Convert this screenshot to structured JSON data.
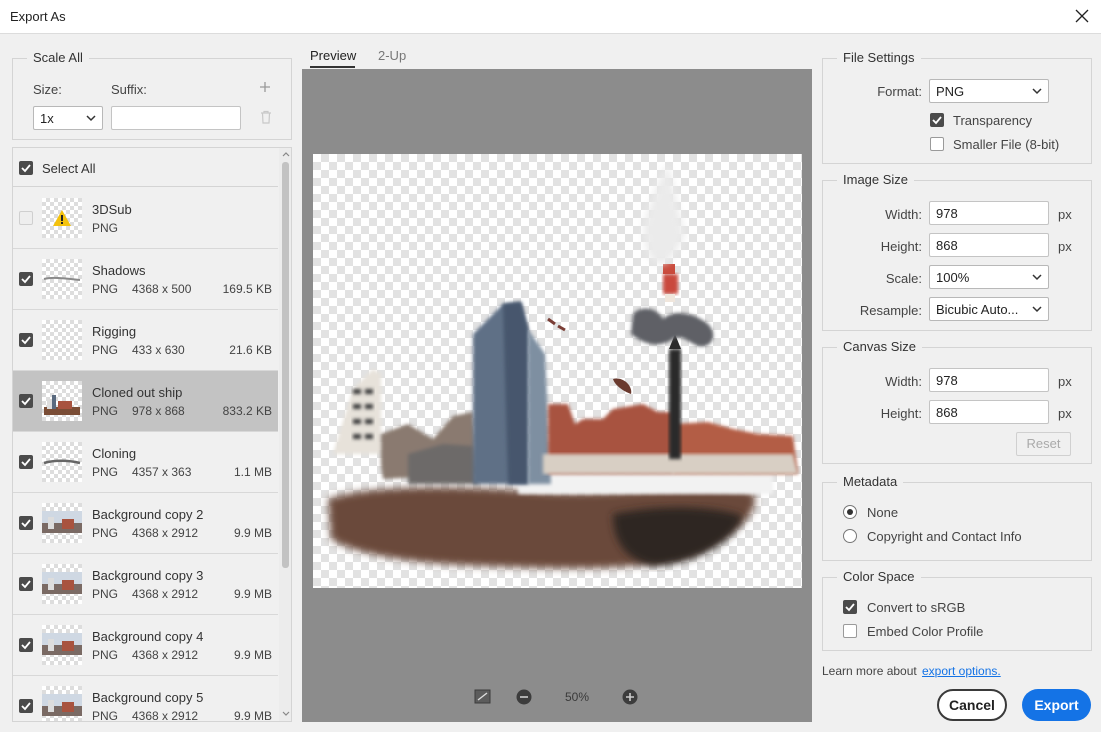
{
  "window": {
    "title": "Export As"
  },
  "scale_all": {
    "legend": "Scale All",
    "size_label": "Size:",
    "suffix_label": "Suffix:",
    "size_value": "1x",
    "suffix_value": ""
  },
  "layers": {
    "select_all_label": "Select All",
    "items": [
      {
        "name": "3DSub",
        "format": "PNG",
        "dims": "",
        "size": "",
        "checked": false,
        "warning": true
      },
      {
        "name": "Shadows",
        "format": "PNG",
        "dims": "4368 x 500",
        "size": "169.5 KB",
        "checked": true
      },
      {
        "name": "Rigging",
        "format": "PNG",
        "dims": "433 x 630",
        "size": "21.6 KB",
        "checked": true
      },
      {
        "name": "Cloned out ship",
        "format": "PNG",
        "dims": "978 x 868",
        "size": "833.2 KB",
        "checked": true,
        "selected": true
      },
      {
        "name": "Cloning",
        "format": "PNG",
        "dims": "4357 x 363",
        "size": "1.1 MB",
        "checked": true
      },
      {
        "name": "Background copy 2",
        "format": "PNG",
        "dims": "4368 x 2912",
        "size": "9.9 MB",
        "checked": true
      },
      {
        "name": "Background copy 3",
        "format": "PNG",
        "dims": "4368 x 2912",
        "size": "9.9 MB",
        "checked": true
      },
      {
        "name": "Background copy 4",
        "format": "PNG",
        "dims": "4368 x 2912",
        "size": "9.9 MB",
        "checked": true
      },
      {
        "name": "Background copy 5",
        "format": "PNG",
        "dims": "4368 x 2912",
        "size": "9.9 MB",
        "checked": true
      }
    ]
  },
  "preview": {
    "tabs": [
      "Preview",
      "2-Up"
    ],
    "active_tab": "Preview",
    "zoom": "50%"
  },
  "file_settings": {
    "legend": "File Settings",
    "format_label": "Format:",
    "format_value": "PNG",
    "transparency_label": "Transparency",
    "transparency_checked": true,
    "smaller_file_label": "Smaller File (8-bit)",
    "smaller_file_checked": false
  },
  "image_size": {
    "legend": "Image Size",
    "width_label": "Width:",
    "width_value": "978",
    "height_label": "Height:",
    "height_value": "868",
    "unit": "px",
    "scale_label": "Scale:",
    "scale_value": "100%",
    "resample_label": "Resample:",
    "resample_value": "Bicubic Auto..."
  },
  "canvas_size": {
    "legend": "Canvas Size",
    "width_label": "Width:",
    "width_value": "978",
    "height_label": "Height:",
    "height_value": "868",
    "unit": "px",
    "reset_label": "Reset"
  },
  "metadata": {
    "legend": "Metadata",
    "options": [
      "None",
      "Copyright and Contact Info"
    ],
    "selected": "None"
  },
  "color_space": {
    "legend": "Color Space",
    "convert_label": "Convert to sRGB",
    "convert_checked": true,
    "embed_label": "Embed Color Profile",
    "embed_checked": false
  },
  "footer": {
    "learn_more": "Learn more about",
    "link_text": "export options.",
    "cancel_label": "Cancel",
    "export_label": "Export"
  },
  "colors": {
    "accent": "#1473e6",
    "link": "#1473e6",
    "canvas_bg": "#8c8c8c",
    "selected_row": "#c3c3c3"
  }
}
